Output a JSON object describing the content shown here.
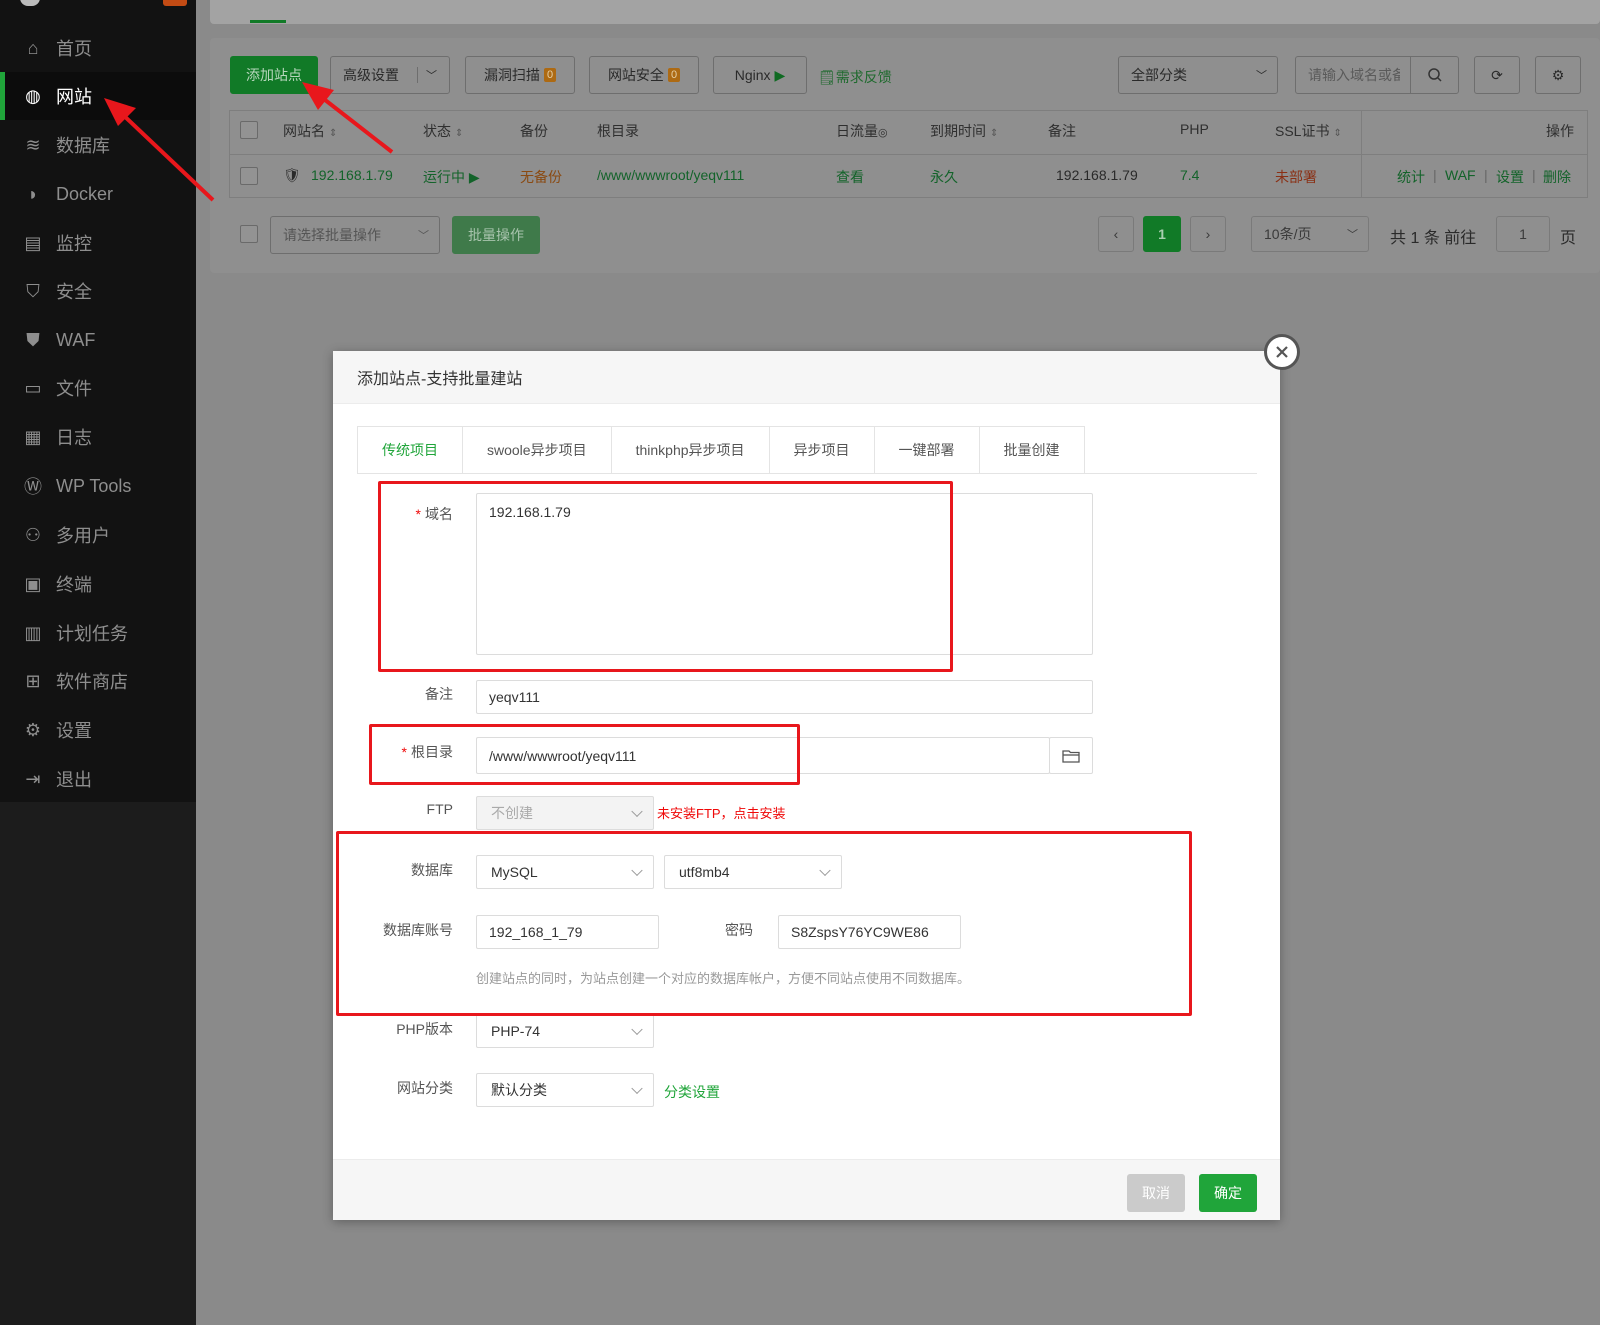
{
  "sidebar": {
    "items": [
      {
        "label": "首页",
        "icon": "home-icon"
      },
      {
        "label": "网站",
        "icon": "globe-icon",
        "active": true
      },
      {
        "label": "数据库",
        "icon": "database-icon"
      },
      {
        "label": "Docker",
        "icon": "docker-icon"
      },
      {
        "label": "监控",
        "icon": "monitor-icon"
      },
      {
        "label": "安全",
        "icon": "shield-icon"
      },
      {
        "label": "WAF",
        "icon": "waf-icon"
      },
      {
        "label": "文件",
        "icon": "folder-icon"
      },
      {
        "label": "日志",
        "icon": "log-icon"
      },
      {
        "label": "WP Tools",
        "icon": "wordpress-icon"
      },
      {
        "label": "多用户",
        "icon": "users-icon"
      },
      {
        "label": "终端",
        "icon": "terminal-icon"
      },
      {
        "label": "计划任务",
        "icon": "calendar-icon"
      },
      {
        "label": "软件商店",
        "icon": "apps-icon"
      },
      {
        "label": "设置",
        "icon": "gear-icon"
      },
      {
        "label": "退出",
        "icon": "logout-icon"
      }
    ]
  },
  "toolbar": {
    "add_site": "添加站点",
    "advanced": "高级设置",
    "vuln_scan": "漏洞扫描",
    "vuln_count": "0",
    "site_security": "网站安全",
    "security_count": "0",
    "nginx": "Nginx",
    "feedback": "需求反馈",
    "category": "全部分类",
    "search_placeholder": "请输入域名或备注"
  },
  "table": {
    "headers": {
      "name": "网站名",
      "status": "状态",
      "backup": "备份",
      "root": "根目录",
      "traffic": "日流量",
      "expire": "到期时间",
      "remark": "备注",
      "php": "PHP",
      "ssl": "SSL证书",
      "ops": "操作"
    },
    "rows": [
      {
        "name": "192.168.1.79",
        "status": "运行中",
        "backup": "无备份",
        "root": "/www/wwwroot/yeqv111",
        "traffic": "查看",
        "expire": "永久",
        "remark": "192.168.1.79",
        "php": "7.4",
        "ssl": "未部署",
        "ops": [
          "统计",
          "WAF",
          "设置",
          "删除"
        ]
      }
    ]
  },
  "batch": {
    "placeholder": "请选择批量操作",
    "button": "批量操作"
  },
  "pagination": {
    "current": "1",
    "per_page": "10条/页",
    "total_prefix": "共",
    "total": "1",
    "total_suffix": "条",
    "goto": "前往",
    "goto_value": "1",
    "page_unit": "页"
  },
  "modal": {
    "title": "添加站点-支持批量建站",
    "tabs": [
      "传统项目",
      "swoole异步项目",
      "thinkphp异步项目",
      "异步项目",
      "一键部署",
      "批量创建"
    ],
    "domain_label": "域名",
    "domain_value": "192.168.1.79",
    "remark_label": "备注",
    "remark_value": "yeqv111",
    "root_label": "根目录",
    "root_value": "/www/wwwroot/yeqv111",
    "ftp_label": "FTP",
    "ftp_value": "不创建",
    "ftp_warning": "未安装FTP，点击安装",
    "db_label": "数据库",
    "db_type": "MySQL",
    "db_charset": "utf8mb4",
    "db_account_label": "数据库账号",
    "db_account": "192_168_1_79",
    "db_password_label": "密码",
    "db_password": "S8ZspsY76YC9WE86",
    "db_hint": "创建站点的同时，为站点创建一个对应的数据库帐户，方便不同站点使用不同数据库。",
    "php_label": "PHP版本",
    "php_value": "PHP-74",
    "category_label": "网站分类",
    "category_value": "默认分类",
    "category_link": "分类设置",
    "cancel": "取消",
    "confirm": "确定"
  },
  "colors": {
    "accent": "#20a53a",
    "annotation_red": "#e8171c",
    "overlay": "#8a8a8a"
  }
}
